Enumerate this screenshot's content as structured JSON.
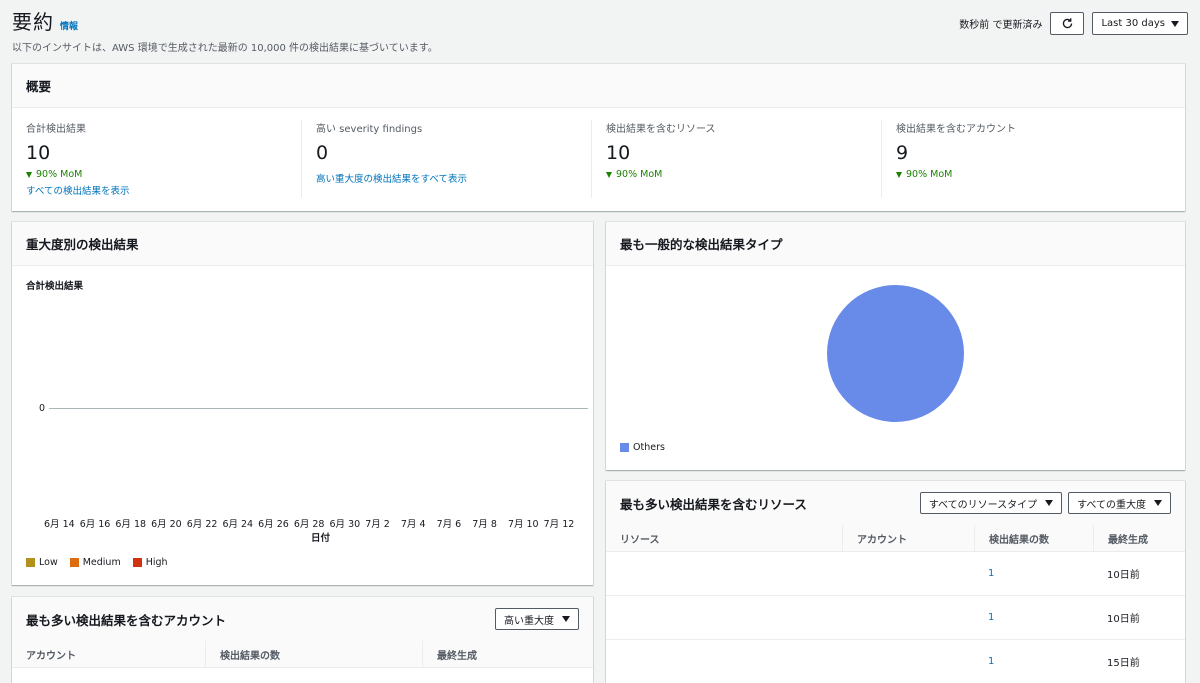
{
  "header": {
    "title": "要約",
    "info": "情報",
    "subtitle": "以下のインサイトは、AWS 環境で生成された最新の 10,000 件の検出結果に基づいています。",
    "updated": "数秒前 で更新済み",
    "range": "Last 30 days"
  },
  "overview": {
    "title": "概要",
    "cols": [
      {
        "label": "合計検出結果",
        "value": "10",
        "mom": "90% MoM",
        "link": "すべての検出結果を表示"
      },
      {
        "label": "高い severity findings",
        "value": "0",
        "link": "高い重大度の検出結果をすべて表示"
      },
      {
        "label": "検出結果を含むリソース",
        "value": "10",
        "mom": "90% MoM"
      },
      {
        "label": "検出結果を含むアカウント",
        "value": "9",
        "mom": "90% MoM"
      }
    ]
  },
  "severity": {
    "title": "重大度別の検出結果",
    "legend": [
      {
        "name": "Low",
        "color": "#b2911c"
      },
      {
        "name": "Medium",
        "color": "#dd6b10"
      },
      {
        "name": "High",
        "color": "#d13212"
      }
    ]
  },
  "chart_data": {
    "type": "line",
    "ylabel": "合計検出結果",
    "xlabel": "日付",
    "x": [
      "6月 14",
      "6月 16",
      "6月 18",
      "6月 20",
      "6月 22",
      "6月 24",
      "6月 26",
      "6月 28",
      "6月 30",
      "7月 2",
      "7月 4",
      "7月 6",
      "7月 8",
      "7月 10",
      "7月 12"
    ],
    "y_ticks": [
      "0"
    ],
    "series": [
      {
        "name": "Low",
        "values": []
      },
      {
        "name": "Medium",
        "values": []
      },
      {
        "name": "High",
        "values": []
      }
    ]
  },
  "types": {
    "title": "最も一般的な検出結果タイプ",
    "legend": "Others",
    "color": "#688ae8"
  },
  "resources": {
    "title": "最も多い検出結果を含むリソース",
    "filter_type": "すべてのリソースタイプ",
    "filter_sev": "すべての重大度",
    "headers": [
      "リソース",
      "アカウント",
      "検出結果の数",
      "最終生成"
    ],
    "rows": [
      {
        "count": "1",
        "last": "10日前"
      },
      {
        "count": "1",
        "last": "10日前"
      },
      {
        "count": "1",
        "last": "15日前"
      }
    ]
  },
  "accounts": {
    "title": "最も多い検出結果を含むアカウント",
    "filter_sev": "高い重大度",
    "headers": [
      "アカウント",
      "検出結果の数",
      "最終生成"
    ]
  }
}
